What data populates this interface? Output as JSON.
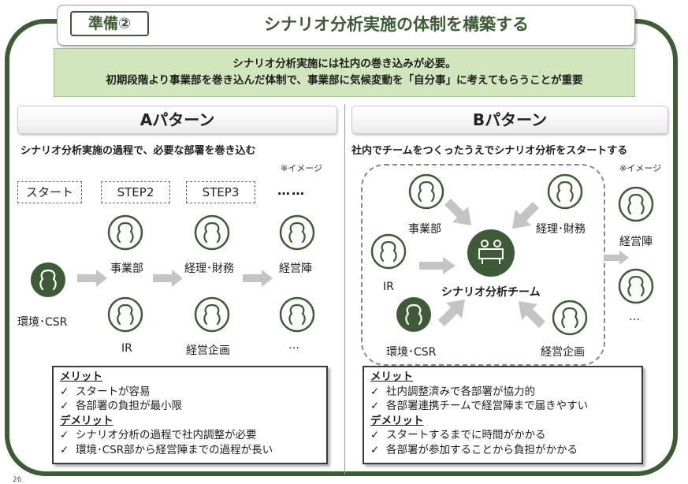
{
  "title": {
    "tag": "準備②",
    "text": "シナリオ分析実施の体制を構築する"
  },
  "banner": {
    "line1": "シナリオ分析実施には社内の巻き込みが必要。",
    "line2": "初期段階より事業部を巻き込んだ体制で、事業部に気候変動を「自分事」に考えてもらうことが重要"
  },
  "pattern_a": {
    "header": "Aパターン",
    "subhead": "シナリオ分析実施の過程で、必要な部署を巻き込む",
    "note": "※イメージ",
    "steps": [
      "スタート",
      "STEP2",
      "STEP3",
      "……"
    ],
    "labels": {
      "env": "環境･CSR",
      "biz": "事業部",
      "fin": "経理･財務",
      "exec": "経営陣",
      "ir": "IR",
      "plan": "経営企画",
      "more": "…"
    },
    "box": {
      "merit_title": "メリット",
      "merits": [
        "スタートが容易",
        "各部署の負担が最小限"
      ],
      "demerit_title": "デメリット",
      "demerits": [
        "シナリオ分析の過程で社内調整が必要",
        "環境･CSR部から経営陣までの過程が長い"
      ]
    }
  },
  "pattern_b": {
    "header": "Bパターン",
    "subhead": "社内でチームをつくったうえでシナリオ分析をスタートする",
    "note": "※イメージ",
    "labels": {
      "biz": "事業部",
      "fin": "経理･財務",
      "ir": "IR",
      "team": "シナリオ分析チーム",
      "env": "環境･CSR",
      "plan": "経営企画",
      "exec": "経営陣",
      "more": "…"
    },
    "box": {
      "merit_title": "メリット",
      "merits": [
        "社内調整済みで各部署が協力的",
        "各部署連携チームで経営陣まで届きやすい"
      ],
      "demerit_title": "デメリット",
      "demerits": [
        "スタートするまでに時間がかかる",
        "各部署が参加することから負担がかかる"
      ]
    }
  },
  "check_mark": "✓",
  "page_number": "26",
  "colors": {
    "accent": "#3e5a36",
    "banner": "#d2e6bd",
    "arrow": "#c4c4c4"
  }
}
